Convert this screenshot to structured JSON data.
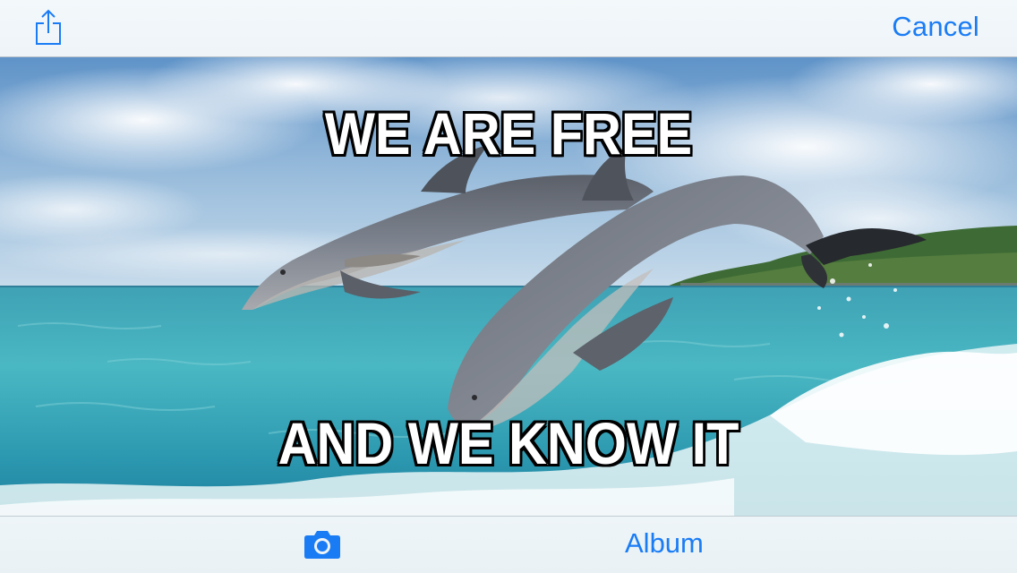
{
  "toolbar": {
    "share_icon": "share-icon",
    "cancel_label": "Cancel"
  },
  "meme": {
    "top_text": "WE ARE FREE",
    "bottom_text": "AND WE KNOW IT",
    "image_subject": "two dolphins leaping over turquoise sea"
  },
  "bottom_toolbar": {
    "camera_icon": "camera-icon",
    "album_label": "Album"
  },
  "colors": {
    "accent": "#1a7cf5",
    "bar_background": "#eef4f8",
    "meme_text": "#ffffff",
    "meme_outline": "#000000"
  }
}
